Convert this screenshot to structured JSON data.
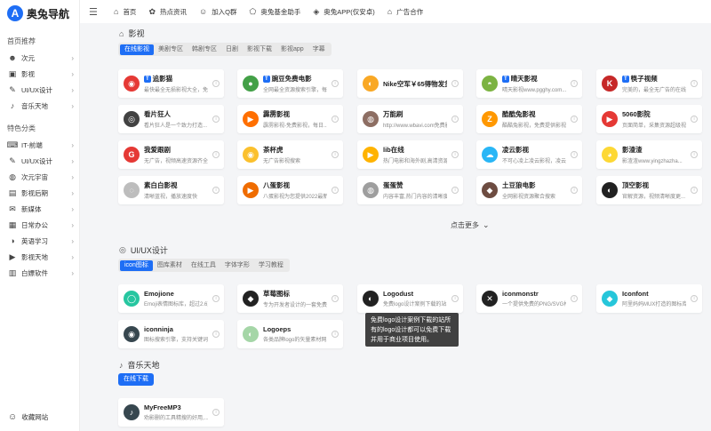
{
  "logo": {
    "mark": "A",
    "text": "奥兔导航"
  },
  "sidebar": {
    "group1": "首页推荐",
    "items1": [
      {
        "label": "次元",
        "icon": "cat-icon"
      },
      {
        "label": "影视",
        "icon": "video-icon"
      },
      {
        "label": "UI/UX设计",
        "icon": "design-icon"
      },
      {
        "label": "音乐天地",
        "icon": "music-icon"
      }
    ],
    "group2": "特色分类",
    "items2": [
      {
        "label": "IT-前端",
        "icon": "code-icon"
      },
      {
        "label": "UI/UX设计",
        "icon": "design-icon"
      },
      {
        "label": "次元宇宙",
        "icon": "planet-icon"
      },
      {
        "label": "影视后期",
        "icon": "film-icon"
      },
      {
        "label": "新媒体",
        "icon": "media-icon"
      },
      {
        "label": "日常办公",
        "icon": "office-icon"
      },
      {
        "label": "英语学习",
        "icon": "english-icon"
      },
      {
        "label": "影视天地",
        "icon": "movie-icon"
      },
      {
        "label": "白嫖软件",
        "icon": "box-icon"
      }
    ],
    "favorite": "收藏网站"
  },
  "topnav": [
    {
      "label": "首页",
      "icon": "home-icon"
    },
    {
      "label": "热点资讯",
      "icon": "fire-icon"
    },
    {
      "label": "加入Q群",
      "icon": "group-icon"
    },
    {
      "label": "奥兔基金助手",
      "icon": "fund-icon"
    },
    {
      "label": "奥兔APP(仅安卓)",
      "icon": "app-icon"
    },
    {
      "label": "广告合作",
      "icon": "ad-icon"
    }
  ],
  "film": {
    "title": "影视",
    "tabs": [
      "在线影视",
      "美剧专区",
      "韩剧专区",
      "日剧",
      "影视下载",
      "影视app",
      "字幕"
    ],
    "cards": [
      {
        "badge": "T",
        "title": "追影猫",
        "desc": "最快最全无损影视大全，免...",
        "color": "#e53935",
        "glyph": "◉"
      },
      {
        "badge": "T",
        "title": "豌豆免费电影",
        "desc": "全网最全资源搜索引擎，每...",
        "color": "#43a047",
        "glyph": "●"
      },
      {
        "badge": "",
        "title": "Nike空军￥65得物发货",
        "desc": "",
        "color": "#f9a825",
        "glyph": "◐"
      },
      {
        "badge": "T",
        "title": "晴天影视",
        "desc": "晴天影视www.pgghy.com...",
        "color": "#7cb342",
        "glyph": "◓"
      },
      {
        "badge": "T",
        "title": "筷子视频",
        "desc": "完美的，最全无广告的在线电影...",
        "color": "#c62828",
        "glyph": "K"
      },
      {
        "badge": "",
        "title": "看片狂人",
        "desc": "看片狂人是一个致力打造...",
        "color": "#424242",
        "glyph": "◎"
      },
      {
        "badge": "",
        "title": "霹雳影视",
        "desc": "霹雳影视-免费影视，每日...",
        "color": "#ff6f00",
        "glyph": "▶"
      },
      {
        "badge": "",
        "title": "万能刷",
        "desc": "http://www.wbavi.com免费影视网站",
        "color": "#8d6e63",
        "glyph": "◍"
      },
      {
        "badge": "",
        "title": "酷酷兔影视",
        "desc": "酷酷兔影视，免费提供影视大全...",
        "color": "#ff9800",
        "glyph": "Z"
      },
      {
        "badge": "",
        "title": "5060影院",
        "desc": "页面简单，采集资源超级视...",
        "color": "#e53935",
        "glyph": "▶"
      },
      {
        "badge": "",
        "title": "我爱跟剧",
        "desc": "无广告，视频高速资源齐全",
        "color": "#e53935",
        "glyph": "G"
      },
      {
        "badge": "",
        "title": "茶杯虎",
        "desc": "无广告影视搜索",
        "color": "#fbc02d",
        "glyph": "◉"
      },
      {
        "badge": "",
        "title": "lib在线",
        "desc": "热门电影和海外剧,高清资源...",
        "color": "#ffb300",
        "glyph": "▶"
      },
      {
        "badge": "",
        "title": "凌云影视",
        "desc": "不可心凌上凌云影视，凌云...",
        "color": "#29b6f6",
        "glyph": "☁"
      },
      {
        "badge": "",
        "title": "影渣渣",
        "desc": "影渣渣www.yingzhazha...",
        "color": "#fdd835",
        "glyph": "◕"
      },
      {
        "badge": "",
        "title": "素白白影视",
        "desc": "清晰蓝视，播放速度快",
        "color": "#bdbdbd",
        "glyph": "◌"
      },
      {
        "badge": "",
        "title": "八蛋影视",
        "desc": "八蛋影视为您提供2022最新...",
        "color": "#ef6c00",
        "glyph": "▶"
      },
      {
        "badge": "",
        "title": "蛋蛋赞",
        "desc": "内容丰富,热门内容的清晰度...",
        "color": "#9e9e9e",
        "glyph": "◍"
      },
      {
        "badge": "",
        "title": "土豆狼电影",
        "desc": "全网影视资源聚合搜索",
        "color": "#6d4c41",
        "glyph": "◆"
      },
      {
        "badge": "",
        "title": "顶空影视",
        "desc": "官解资源，视频清晰度更...",
        "color": "#212121",
        "glyph": "◐"
      }
    ],
    "load_more": "点击更多"
  },
  "uiux": {
    "title": "UI/UX设计",
    "tabs": [
      "icon图标",
      "图库素材",
      "在线工具",
      "字体字形",
      "学习教程"
    ],
    "cards": [
      {
        "title": "Emojione",
        "desc": "Emoji表情图标库，超过2.6万...",
        "color": "#26c6a0",
        "glyph": "◯"
      },
      {
        "title": "草莓图标",
        "desc": "专为开发者设计的一套免费...",
        "color": "#222222",
        "glyph": "◆"
      },
      {
        "title": "Logodust",
        "desc": "免费logo设计案例下载的站...",
        "color": "#222222",
        "glyph": "◐"
      },
      {
        "title": "iconmonstr",
        "desc": "一个提供免费的PNG/SVG格式...",
        "color": "#222222",
        "glyph": "✕"
      },
      {
        "title": "Iconfont",
        "desc": "阿里妈妈MUX打造的图标库...",
        "color": "#26c6da",
        "glyph": "◆"
      },
      {
        "title": "iconninja",
        "desc": "图标搜索引擎，支持关键词...",
        "color": "#37474f",
        "glyph": "◉"
      },
      {
        "title": "Logoeps",
        "desc": "各类品牌logo的矢量素材网...",
        "color": "#a5d6a7",
        "glyph": "◐"
      }
    ],
    "tooltip": "免费logo设计案例下载的站所有的logo设计都可以免费下载并用于商业项目使用。"
  },
  "music": {
    "title": "音乐天地",
    "tabs": [
      "在线下载"
    ],
    "cards": [
      {
        "title": "MyFreeMP3",
        "desc": "劝影删的工具精搜的好用,...",
        "color": "#37474f",
        "glyph": "♪"
      }
    ]
  }
}
